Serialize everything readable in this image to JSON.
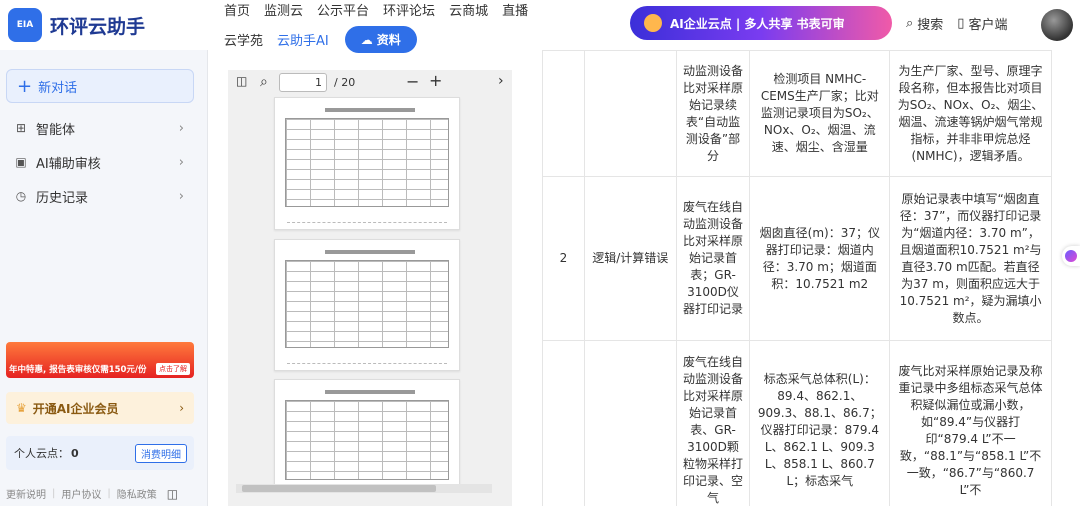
{
  "header": {
    "logo_badge": "EIA",
    "logo_text": "环评云助手",
    "nav_row1": [
      "首页",
      "监测云",
      "公示平台",
      "环评论坛",
      "云商城",
      "直播"
    ],
    "nav_row2": [
      "云学苑",
      "云助手AI"
    ],
    "nav_button": "资料",
    "promo_text": "AI企业云点 | 多人共享 书表可审",
    "search_label": "搜索",
    "client_label": "客户端"
  },
  "sidebar": {
    "new_chat": "新对话",
    "items": [
      {
        "label": "智能体",
        "icon": "agent-icon"
      },
      {
        "label": "AI辅助审核",
        "icon": "ai-review-icon"
      },
      {
        "label": "历史记录",
        "icon": "history-icon"
      }
    ],
    "banner_text": "年中特惠, 报告表审核仅需150元/份",
    "banner_tag": "点击了解",
    "vip_label": "开通AI企业会员",
    "points_label": "个人云点：",
    "points_value": "0",
    "points_button": "消费明细",
    "footer_links": [
      "更新说明",
      "用户协议",
      "隐私政策"
    ]
  },
  "pdf": {
    "current_page": "1",
    "total_pages": "/ 20"
  },
  "table": {
    "rows": [
      {
        "no": "",
        "type": "",
        "obj": "动监测设备比对采样原始记录续表“自动监测设备”部分",
        "data": "检测项目 NMHC-CEMS生产厂家；比对监测记录项目为SO₂、NOx、O₂、烟温、流速、烟尘、含湿量",
        "desc": "为生产厂家、型号、原理字段名称，但本报告比对项目为SO₂、NOx、O₂、烟尘、烟温、流速等锅炉烟气常规指标，并非非甲烷总烃(NMHC)，逻辑矛盾。"
      },
      {
        "no": "2",
        "type": "逻辑/计算错误",
        "obj": "废气在线自动监测设备比对采样原始记录首表；GR-3100D仪器打印记录",
        "data": "烟囱直径(m)：37；仪器打印记录：烟道内径：3.70 m；烟道面积：10.7521 m2",
        "desc": "原始记录表中填写“烟囱直径：37”，而仪器打印记录为“烟道内径：3.70 m”，且烟道面积10.7521 m²与直径3.70 m匹配。若直径为37 m，则面积应远大于10.7521 m²，疑为漏填小数点。"
      },
      {
        "no": "",
        "type": "",
        "obj": "废气在线自动监测设备比对采样原始记录首表、GR-3100D颗粒物采样打印记录、空气",
        "data": "标态采气总体积(L)：89.4、862.1、909.3、88.1、86.7；仪器打印记录：879.4 L、862.1 L、909.3 L、858.1 L、860.7 L；标态采气",
        "desc": "废气比对采样原始记录及称重记录中多组标态采气总体积疑似漏位或漏小数，如“89.4”与仪器打印“879.4 L”不一致，“88.1”与“858.1 L”不一致，“86.7”与“860.7 L”不"
      }
    ]
  }
}
